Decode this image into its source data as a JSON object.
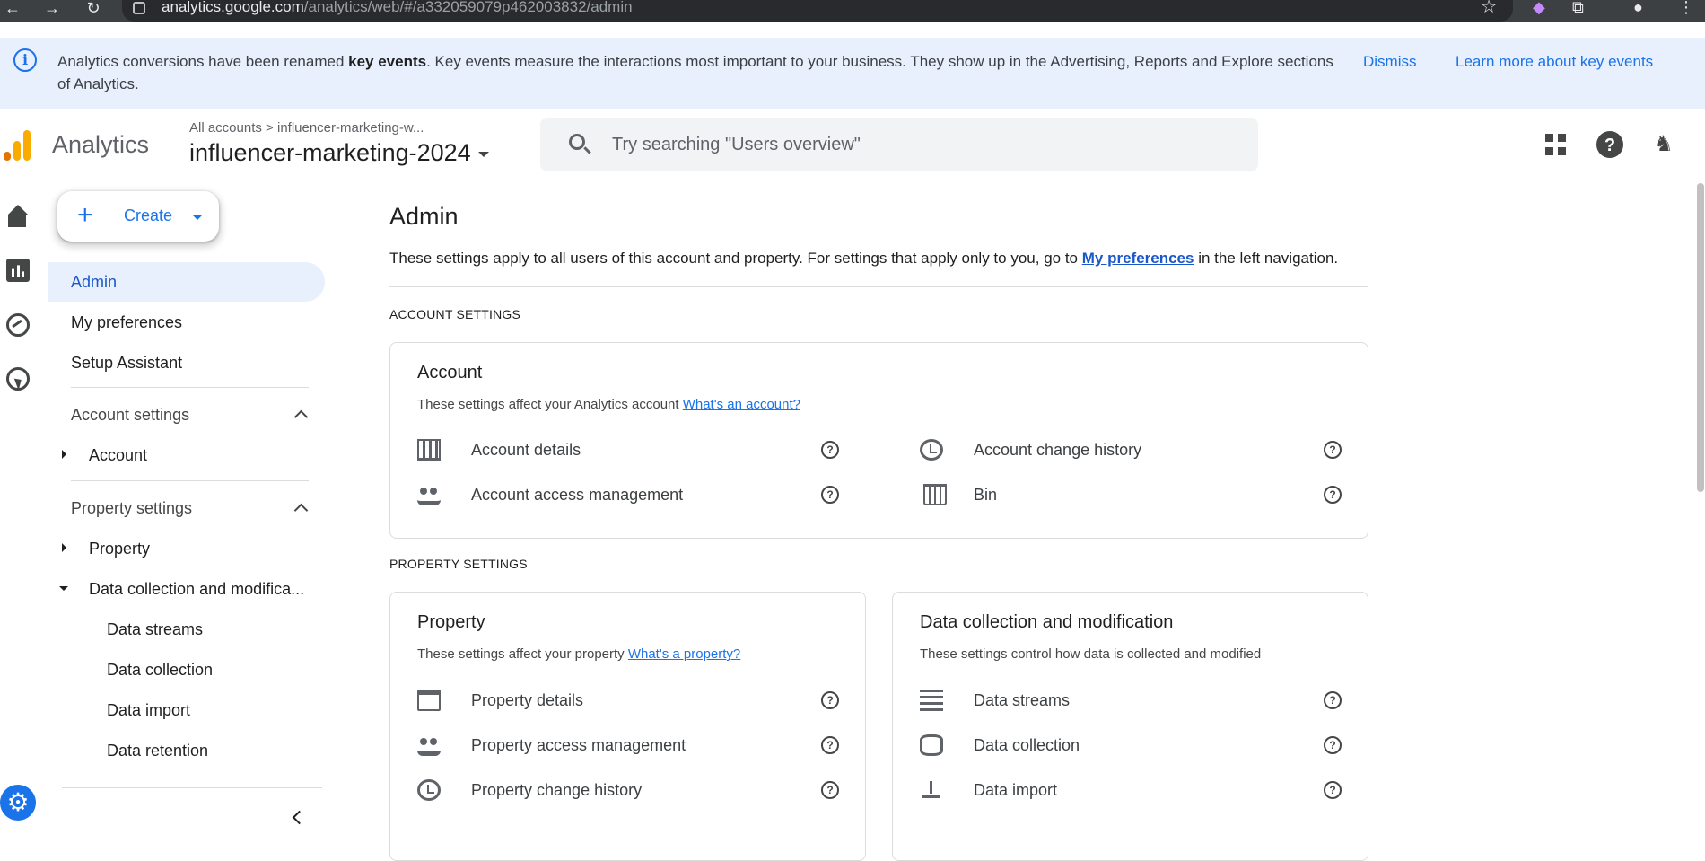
{
  "browser": {
    "url_host": "analytics.google.com",
    "url_path": "/analytics/web/#/a332059079p462003832/admin"
  },
  "banner": {
    "message_prefix": "Analytics conversions have been renamed ",
    "message_bold": "key events",
    "message_suffix": ". Key events measure the interactions most important to your business. They show up in the Advertising, Reports and Explore sections of Analytics.",
    "dismiss_label": "Dismiss",
    "learn_more_label": "Learn more about key events"
  },
  "header": {
    "app_title": "Analytics",
    "breadcrumb_root": "All accounts",
    "breadcrumb_separator": ">",
    "breadcrumb_account": "influencer-marketing-w...",
    "property_name": "influencer-marketing-2024",
    "search_placeholder": "Try searching \"Users overview\""
  },
  "sidenav": {
    "create_label": "Create",
    "items": {
      "admin": "Admin",
      "my_preferences": "My preferences",
      "setup_assistant": "Setup Assistant"
    },
    "account_settings": {
      "header": "Account settings",
      "account": "Account"
    },
    "property_settings": {
      "header": "Property settings",
      "property": "Property",
      "data_collection": "Data collection and modifica...",
      "children": {
        "data_streams": "Data streams",
        "data_collection": "Data collection",
        "data_import": "Data import",
        "data_retention": "Data retention"
      }
    }
  },
  "main": {
    "title": "Admin",
    "desc_prefix": "These settings apply to all users of this account and property. For settings that apply only to you, go to ",
    "desc_link": "My preferences",
    "desc_suffix": " in the left navigation.",
    "account_section_label": "ACCOUNT SETTINGS",
    "property_section_label": "PROPERTY SETTINGS",
    "account_card": {
      "title": "Account",
      "subtitle": "These settings affect your Analytics account ",
      "subtitle_link": "What's an account?",
      "rows": {
        "account_details": "Account details",
        "account_access": "Account access management",
        "account_history": "Account change history",
        "bin": "Bin"
      }
    },
    "property_card": {
      "title": "Property",
      "subtitle": "These settings affect your property ",
      "subtitle_link": "What's a property?",
      "rows": {
        "property_details": "Property details",
        "property_access": "Property access management",
        "property_history": "Property change history"
      }
    },
    "data_card": {
      "title": "Data collection and modification",
      "subtitle": "These settings control how data is collected and modified",
      "rows": {
        "data_streams": "Data streams",
        "data_collection": "Data collection",
        "data_import": "Data import"
      }
    },
    "help_glyph": "?"
  },
  "colors": {
    "accent": "#1a73e8",
    "banner_bg": "#e8f0fe",
    "active_nav_bg": "#e8f0fe",
    "logo_orange": "#f9ab00",
    "logo_dark_orange": "#e37400"
  }
}
